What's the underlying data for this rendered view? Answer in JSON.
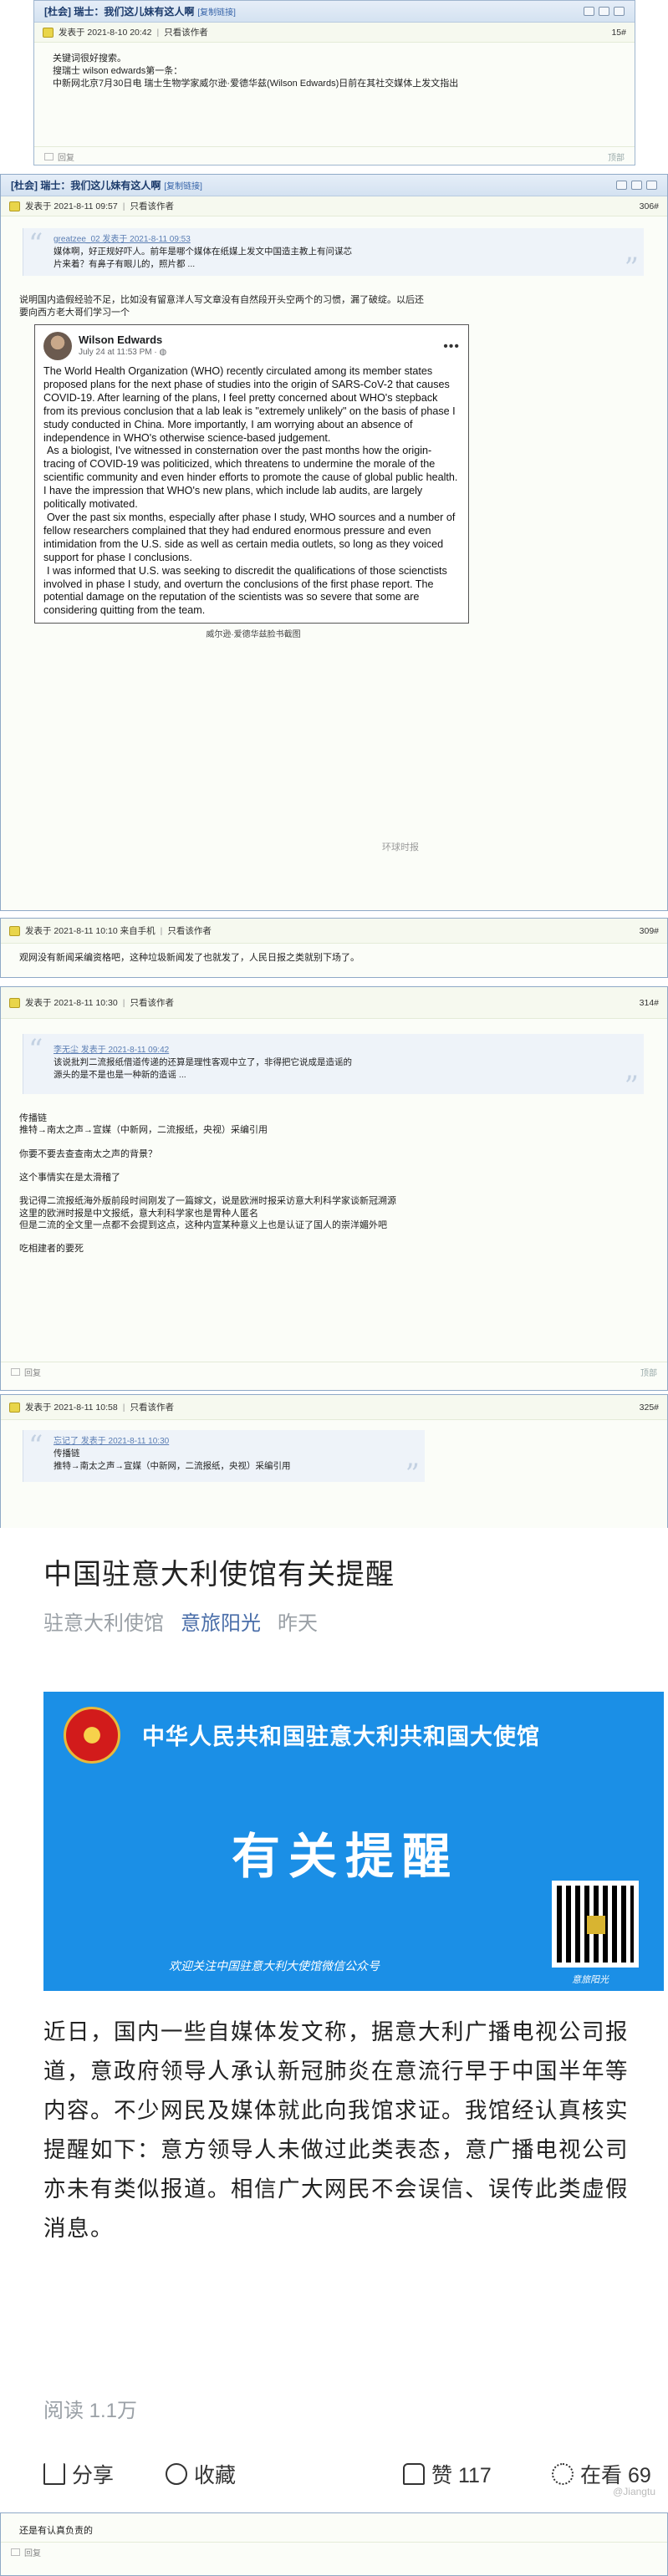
{
  "board_tag": "[杜会]",
  "thread_title": "瑞士：我们这儿妹有这人啊",
  "copy_link": "[复制链接]",
  "posted_label": "发表于",
  "only_author": "只看该作者",
  "reply_label": "回复",
  "top_label": "顶部",
  "post15": {
    "date": "2021-8-10 20:42",
    "floor": "15#",
    "lines": [
      "关键词很好搜索。",
      "搜瑞士 wilson edwards第一条：",
      "中新网北京7月30日电 瑞士生物学家威尔逊·爱德华兹(Wilson Edwards)日前在其社交媒体上发文指出"
    ]
  },
  "post306": {
    "date": "2021-8-11 09:57",
    "floor": "306#",
    "quote_head": "greatzee_02 发表于 2021-8-11 09:53",
    "quote_lines": [
      "媒体啊，好正规好吓人。前年是哪个媒体在纸媒上发文中国造主教上有问谋芯",
      "片来着？有鼻子有眼儿的，照片都 ..."
    ],
    "after_quote": [
      "说明国内造假经验不足，比如没有留意洋人写文章没有自然段开头空两个的习惯，漏了破绽。以后还",
      "要向西方老大哥们学习一个"
    ],
    "fb": {
      "name": "Wilson Edwards",
      "date": "July 24 at 11:53 PM · ",
      "dots": "•••",
      "paragraphs": [
        "The World Health Organization (WHO) recently circulated among its member states proposed plans for the next phase of studies into the origin of SARS-CoV-2 that causes COVID-19. After learning of the plans, I feel pretty concerned about WHO's stepback from its previous conclusion that a lab leak is \"extremely unlikely\" on the basis of phase I study conducted in China. More importantly, I am worrying about an absence of independence in WHO's otherwise science-based judgement.",
        "As a biologist, I've witnessed in consternation over the past months how the origin-tracing of COVID-19 was politicized, which threatens to undermine the morale of the scientific community and even hinder efforts to promote the cause of global public health. I have the impression that WHO's new plans, which include lab audits, are largely politically motivated.",
        "Over the past six months, especially after phase I study, WHO sources and a number of fellow researchers complained that they had endured enormous pressure and even intimidation from the U.S. side as well as certain media outlets, so long as they voiced support for phase I conclusions.",
        "I was informed that U.S. was seeking to discredit the qualifications of those scienctists involved in phase I study, and overturn the conclusions of the first phase report. The potential damage on the reputation of the scientists was so severe that some are considering quitting from the team."
      ],
      "watermark": "环球时报"
    },
    "caption": "威尔逊·爱德华兹脸书截图"
  },
  "post309": {
    "date": "2021-8-11 10:10",
    "via": "来自手机",
    "floor": "309#",
    "line": "观网没有新闻采编资格吧，这种垃圾新闻发了也就发了，人民日报之类就别下场了。"
  },
  "post314": {
    "date": "2021-8-11 10:30",
    "floor": "314#",
    "quote_head": "李无尘 发表于 2021-8-11 09:42",
    "quote_lines": [
      "该说批判二流报纸借道传递的还算是理性客观中立了，非得把它说成是造谣的",
      "源头的是不是也是一种新的造谣 ..."
    ],
    "lines": [
      "传播链",
      "推特→南太之声→宣媒（中新网，二流报纸，央视）采编引用",
      "",
      "你要不要去查查南太之声的背景？",
      "",
      "这个事情实在是太滑稽了",
      "",
      "我记得二流报纸海外版前段时间刚发了一篇嫁文，说是欧洲时报采访意大利科学家谈新冠溯源",
      "这里的欧洲时报是中文报纸，意大利科学家也是胃种人匿名",
      "但是二流的全文里一点都不会提到这点，这种内宣某种意义上也是认证了国人的崇洋媚外吧",
      "",
      "吃相建者的要死"
    ]
  },
  "post325": {
    "date": "2021-8-11 10:58",
    "floor": "325#",
    "quote_head": "忘记了 发表于 2021-8-11 10:30",
    "quote_lines": [
      "传播链",
      "推特→南太之声→宣媒（中新网，二流报纸，央视）采编引用"
    ]
  },
  "weibo": {
    "title": "中国驻意大利使馆有关提醒",
    "source": "驻意大利使馆",
    "account": "意旅阳光",
    "time": "昨天",
    "banner_title": "中华人民共和国驻意大利共和国大使馆",
    "banner_big": "有关提醒",
    "banner_foot": "欢迎关注中国驻意大利大使馆微信公众号",
    "banner_sig": "意旅阳光",
    "body": "近日，国内一些自媒体发文称，据意大利广播电视公司报道，意政府领导人承认新冠肺炎在意流行早于中国半年等内容。不少网民及媒体就此向我馆求证。我馆经认真核实提醒如下：意方领导人未做过此类表态，意广播电视公司亦未有类似报道。相信广大网民不会误信、误传此类虚假消息。",
    "reads": "阅读 1.1万",
    "share": "分享",
    "collect": "收藏",
    "like": "赞 117",
    "watching": "在看 69",
    "watermark": "@Jiangtu"
  },
  "last_line": "还是有认真负责的"
}
